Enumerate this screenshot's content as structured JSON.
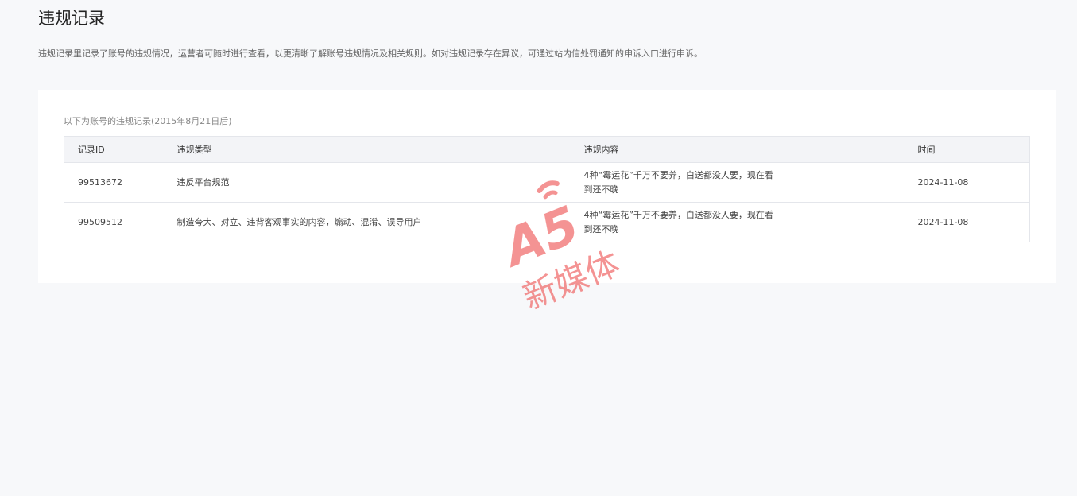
{
  "header": {
    "title": "违规记录",
    "description": "违规记录里记录了账号的违规情况，运营者可随时进行查看，以更清晰了解账号违规情况及相关规则。如对违规记录存在异议，可通过站内信处罚通知的申诉入口进行申诉。"
  },
  "records": {
    "caption": "以下为账号的违规记录(2015年8月21日后)",
    "columns": {
      "id": "记录ID",
      "type": "违规类型",
      "content": "违规内容",
      "time": "时间"
    },
    "rows": [
      {
        "id": "99513672",
        "type": "违反平台规范",
        "content": "4种“霉运花”千万不要养，白送都没人要，现在看到还不晚",
        "time": "2024-11-08"
      },
      {
        "id": "99509512",
        "type": "制造夸大、对立、违背客观事实的内容，煽动、混淆、误导用户",
        "content": "4种“霉运花”千万不要养，白送都没人要，现在看到还不晚",
        "time": "2024-11-08"
      }
    ]
  },
  "watermark": {
    "logo_text": "A5",
    "label": "新媒体",
    "color": "#f06a6a"
  }
}
